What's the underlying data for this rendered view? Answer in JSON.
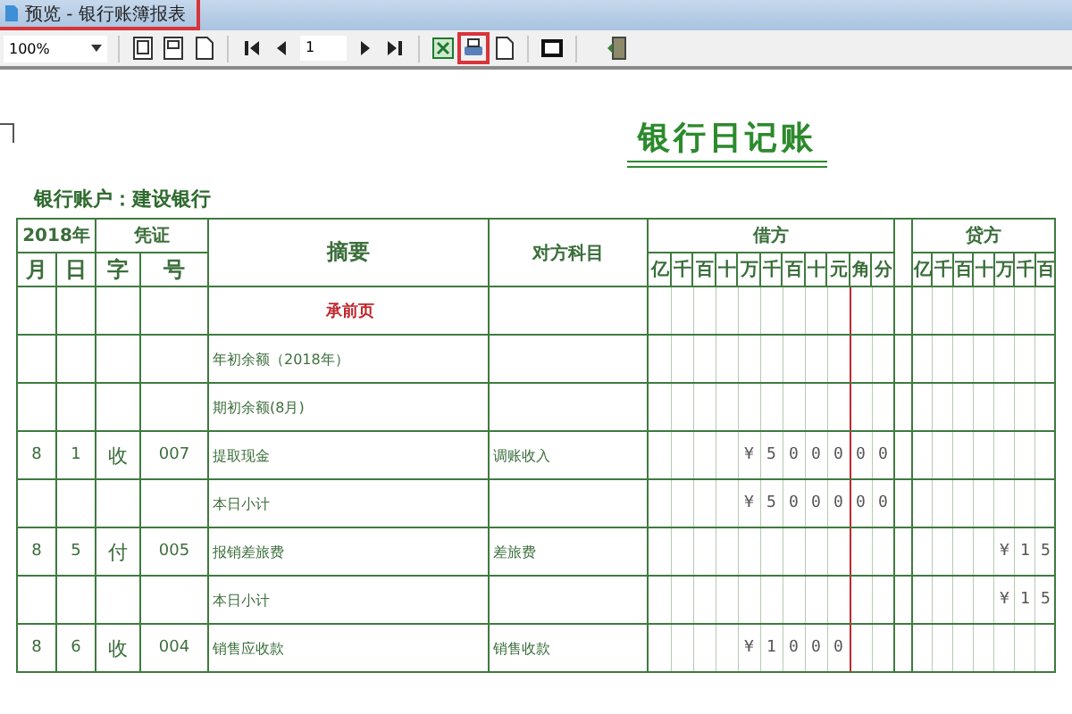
{
  "window": {
    "title": "预览 - 银行账簿报表"
  },
  "toolbar": {
    "zoom": "100%",
    "page": "1"
  },
  "report": {
    "title": "银行日记账",
    "account_label": "银行账户：建设银行",
    "header": {
      "year": "2018年",
      "voucher": "凭证",
      "month": "月",
      "day": "日",
      "type": "字",
      "number": "号",
      "summary": "摘要",
      "counter_account": "对方科目",
      "debit": "借方",
      "credit": "贷方",
      "debit_units": [
        "亿",
        "千",
        "百",
        "十",
        "万",
        "千",
        "百",
        "十",
        "元",
        "角",
        "分"
      ],
      "credit_units": [
        "亿",
        "千",
        "百",
        "十",
        "万",
        "千",
        "百"
      ]
    },
    "rows": [
      {
        "kind": "carry_forward",
        "summary": "承前页"
      },
      {
        "kind": "entry",
        "summary": "年初余额（2018年）"
      },
      {
        "kind": "entry",
        "summary": "期初余额(8月)"
      },
      {
        "kind": "entry",
        "month": "8",
        "day": "1",
        "type": "收",
        "number": "007",
        "summary": "提取现金",
        "counter_account": "调账收入",
        "debit": "¥500000"
      },
      {
        "kind": "entry",
        "summary": "本日小计",
        "debit": "¥500000"
      },
      {
        "kind": "entry",
        "month": "8",
        "day": "5",
        "type": "付",
        "number": "005",
        "summary": "报销差旅费",
        "counter_account": "差旅费",
        "credit": "¥15"
      },
      {
        "kind": "entry",
        "summary": "本日小计",
        "credit": "¥15"
      },
      {
        "kind": "entry",
        "month": "8",
        "day": "6",
        "type": "收",
        "number": "004",
        "summary": "销售应收款",
        "counter_account": "销售收款",
        "debit": "¥1000"
      }
    ]
  }
}
